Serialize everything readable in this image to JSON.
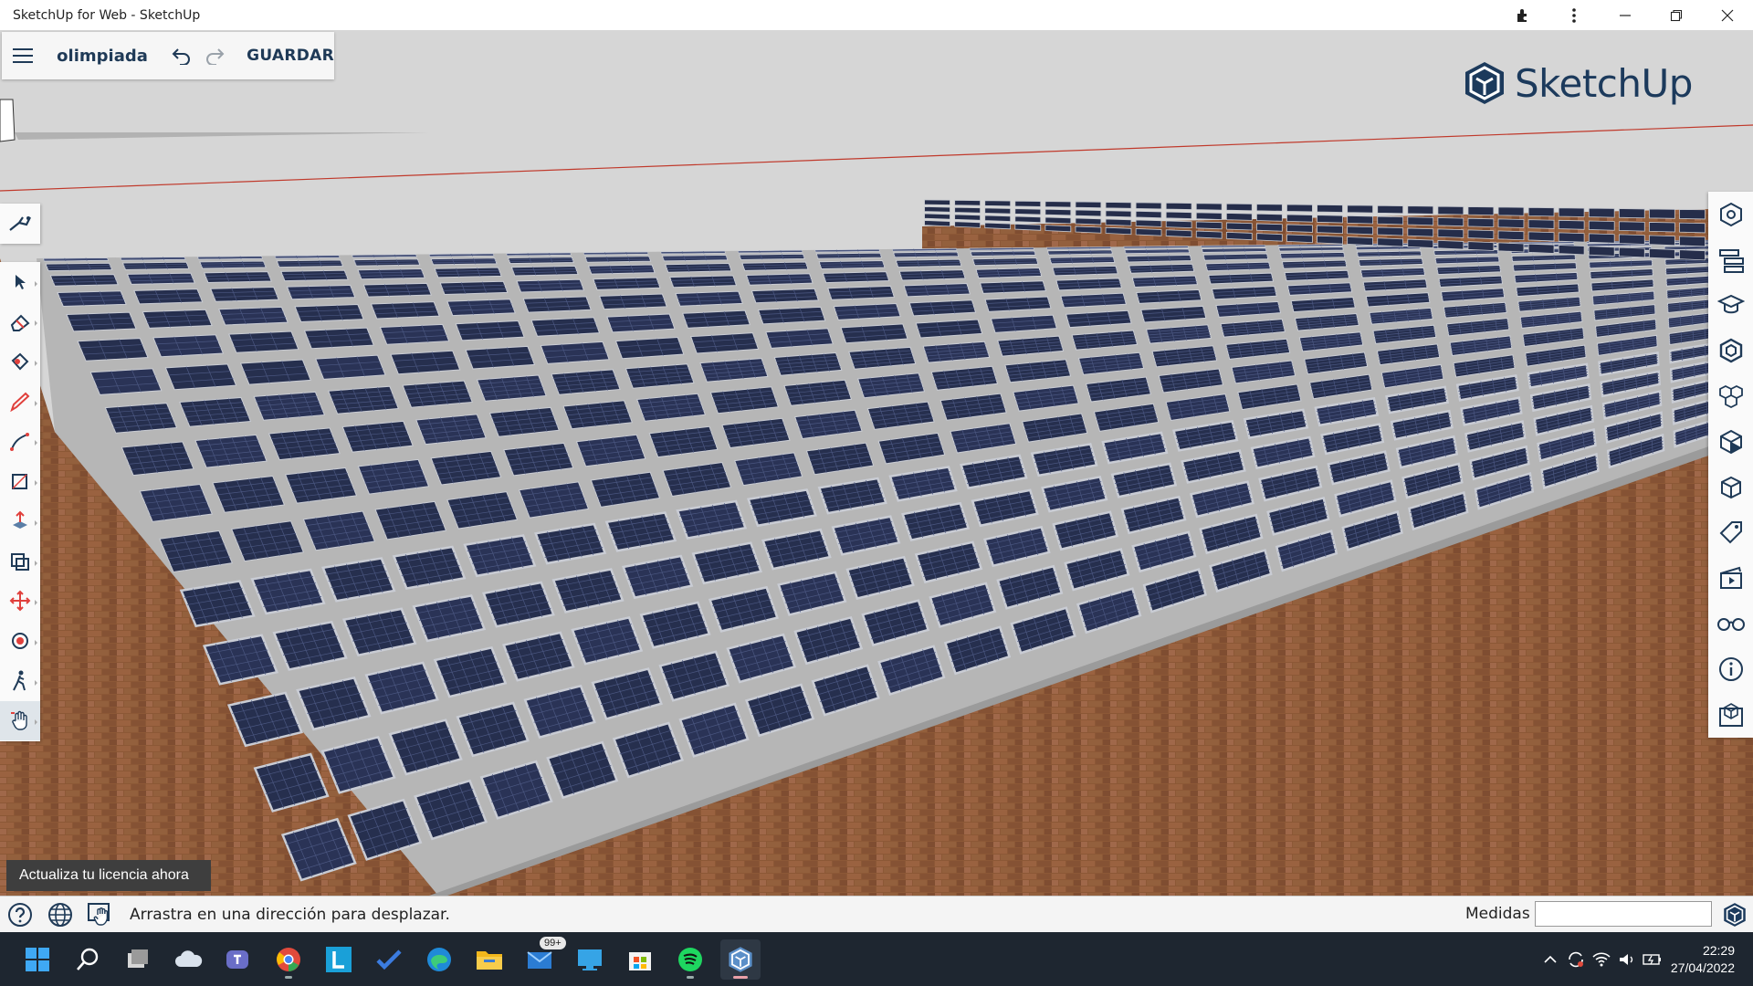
{
  "window": {
    "title": "SketchUp for Web - SketchUp",
    "icons": [
      "extensions-icon",
      "more-options-icon",
      "minimize-icon",
      "restore-icon",
      "close-icon"
    ]
  },
  "appbar": {
    "file_name": "olimpiada",
    "save_label": "GUARDAR",
    "icons": [
      "hamburger-menu-icon",
      "undo-icon",
      "redo-icon"
    ]
  },
  "brand": {
    "name": "SketchUp",
    "color": "#1c3a5c"
  },
  "left_toolbar": {
    "top_tool": "search-tool-icon",
    "tools": [
      "select-icon",
      "eraser-icon",
      "paint-bucket-icon",
      "pencil-icon",
      "arc-icon",
      "rectangle-icon",
      "push-pull-icon",
      "offset-icon",
      "move-icon",
      "orbit-icon",
      "walk-icon",
      "pan-icon"
    ],
    "active_tool": "pan-icon"
  },
  "right_panel": {
    "items": [
      "entity-info-icon",
      "outliner-icon",
      "instructor-icon",
      "components-icon",
      "materials-icon",
      "styles-icon",
      "scenes-icon",
      "tags-icon",
      "animation-icon",
      "display-icon",
      "model-info-icon",
      "3d-warehouse-icon"
    ]
  },
  "license_badge": "Actualiza tu licencia ahora",
  "statusbar": {
    "message": "Arrastra en una dirección para desplazar.",
    "measurements_label": "Medidas",
    "measurements_value": "",
    "icons": [
      "help-icon",
      "globe-icon",
      "pan-hint-icon"
    ]
  },
  "taskbar": {
    "apps": [
      "windows-start-icon",
      "search-icon",
      "task-view-icon",
      "onedrive-icon",
      "teams-icon",
      "chrome-icon",
      "l-app-icon",
      "todo-icon",
      "edge-icon",
      "file-explorer-icon",
      "mail-icon",
      "remote-desktop-icon",
      "store-icon",
      "spotify-icon",
      "sketchup-icon"
    ],
    "mail_badge": "99+",
    "tray_icons": [
      "chevron-up-icon",
      "sync-icon",
      "wifi-icon",
      "volume-icon",
      "battery-icon"
    ],
    "time": "22:29",
    "date": "27/04/2022"
  },
  "colors": {
    "accent": "#1f3a57",
    "panel": "#1c2340",
    "brick": "#8f5a3a",
    "taskbar": "#1e2630"
  }
}
